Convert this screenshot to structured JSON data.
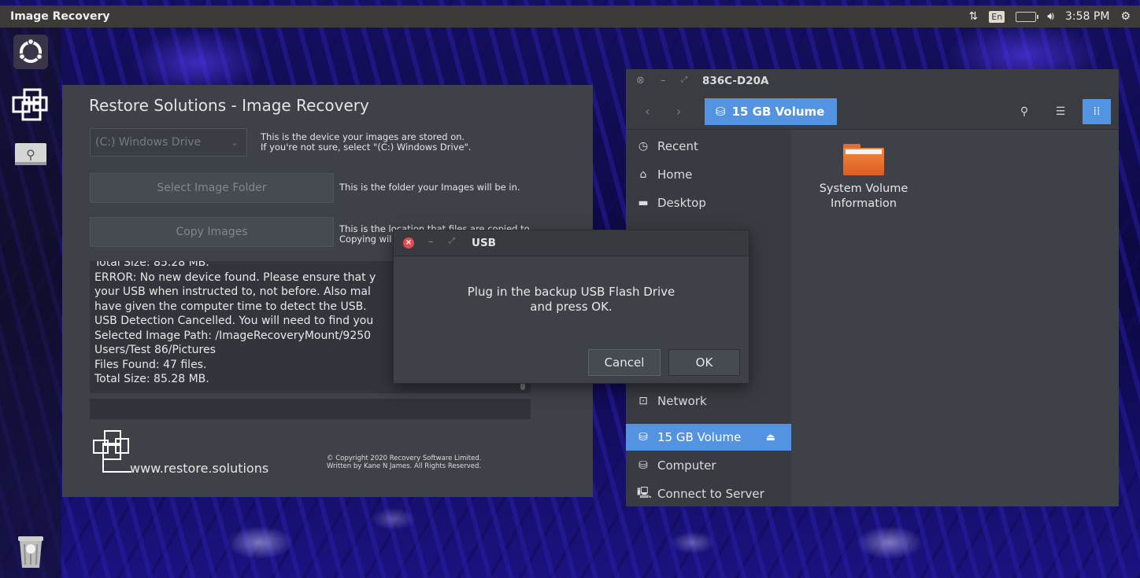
{
  "topbar": {
    "app_title": "Image Recovery",
    "keyboard_layout": "En",
    "clock": "3:58 PM"
  },
  "launcher": {
    "items": [
      {
        "icon": "ubuntu-dash-icon"
      },
      {
        "icon": "restore-solutions-app-icon"
      },
      {
        "icon": "usb-drive-icon"
      },
      {
        "icon": "trash-icon"
      }
    ]
  },
  "restore_window": {
    "title": "Restore Solutions - Image Recovery",
    "drive_select": {
      "value": "(C:) Windows Drive"
    },
    "drive_note_line1": "This is the device your images are stored on.",
    "drive_note_line2": "If you're not sure, select \"(C:) Windows Drive\".",
    "select_folder_button": "Select Image Folder",
    "select_folder_note": "This is the folder your Images will be in.",
    "copy_images_button": "Copy Images",
    "copy_note_line1": "This is the location that files are copied to",
    "copy_note_line2": "Copying wil",
    "log_lines": [
      "Total Size: 85.28 MB.",
      "ERROR: No new device found. Please ensure that y",
      "your USB when instructed to, not before. Also mal",
      "have given the computer time to detect the USB.",
      "USB Detection Cancelled. You will need to find you",
      "Selected Image Path: /ImageRecoveryMount/9250",
      "Users/Test 86/Pictures",
      "Files Found: 47 files.",
      "Total Size: 85.28 MB."
    ],
    "footer_url": "www.restore.solutions",
    "copyright_line1": "© Copyright 2020 Recovery Software Limited.",
    "copyright_line2": "Written by Kane N James. All Rights Reserved."
  },
  "file_manager": {
    "title": "836C-D20A",
    "path_button": "15 GB Volume",
    "sidebar": [
      {
        "label": "Recent",
        "icon": "clock-icon"
      },
      {
        "label": "Home",
        "icon": "home-icon"
      },
      {
        "label": "Desktop",
        "icon": "folder-icon"
      },
      {
        "label": "Network",
        "icon": "network-icon"
      },
      {
        "label": "15 GB Volume",
        "icon": "drive-icon",
        "selected": true
      },
      {
        "label": "Computer",
        "icon": "drive-icon"
      },
      {
        "label": "Connect to Server",
        "icon": "server-icon"
      }
    ],
    "items": [
      {
        "name_line1": "System Volume",
        "name_line2": "Information",
        "icon": "folder-icon"
      }
    ]
  },
  "usb_dialog": {
    "title": "USB",
    "message_line1": "Plug in the backup USB Flash Drive",
    "message_line2": "and press OK.",
    "cancel_label": "Cancel",
    "ok_label": "OK"
  },
  "colors": {
    "accent": "#5294e2",
    "window_bg": "#3e4148",
    "panel_bg": "#3c3b37",
    "close_red": "#e04c4c",
    "folder_orange": "#e86f2c"
  }
}
